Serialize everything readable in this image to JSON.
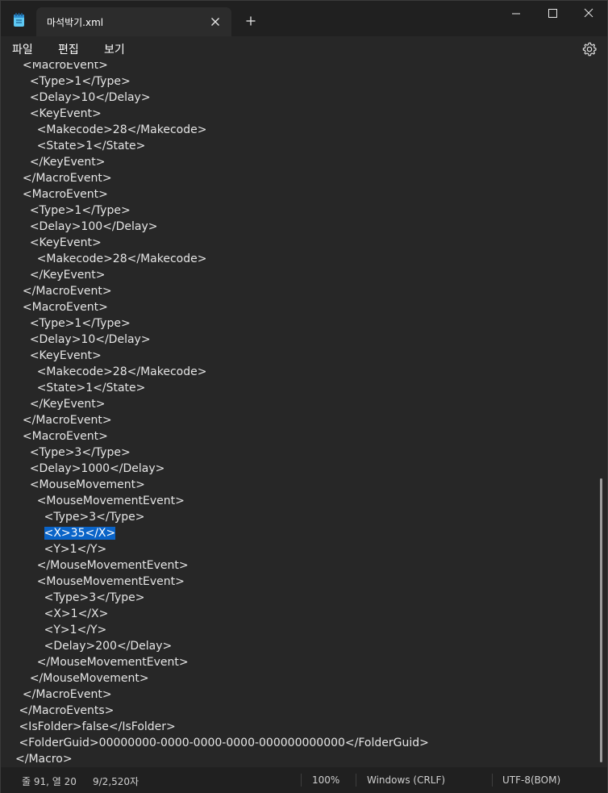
{
  "window": {
    "tab_title": "마석박기.xml"
  },
  "menu": {
    "file": "파일",
    "edit": "편집",
    "view": "보기"
  },
  "editor": {
    "lines": [
      {
        "indent": "  ",
        "text": "<MacroEvent>"
      },
      {
        "indent": "    ",
        "text": "<Type>1</Type>"
      },
      {
        "indent": "    ",
        "text": "<Delay>10</Delay>"
      },
      {
        "indent": "    ",
        "text": "<KeyEvent>"
      },
      {
        "indent": "      ",
        "text": "<Makecode>28</Makecode>"
      },
      {
        "indent": "      ",
        "text": "<State>1</State>"
      },
      {
        "indent": "    ",
        "text": "</KeyEvent>"
      },
      {
        "indent": "  ",
        "text": "</MacroEvent>"
      },
      {
        "indent": "  ",
        "text": "<MacroEvent>"
      },
      {
        "indent": "    ",
        "text": "<Type>1</Type>"
      },
      {
        "indent": "    ",
        "text": "<Delay>100</Delay>"
      },
      {
        "indent": "    ",
        "text": "<KeyEvent>"
      },
      {
        "indent": "      ",
        "text": "<Makecode>28</Makecode>"
      },
      {
        "indent": "    ",
        "text": "</KeyEvent>"
      },
      {
        "indent": "  ",
        "text": "</MacroEvent>"
      },
      {
        "indent": "  ",
        "text": "<MacroEvent>"
      },
      {
        "indent": "    ",
        "text": "<Type>1</Type>"
      },
      {
        "indent": "    ",
        "text": "<Delay>10</Delay>"
      },
      {
        "indent": "    ",
        "text": "<KeyEvent>"
      },
      {
        "indent": "      ",
        "text": "<Makecode>28</Makecode>"
      },
      {
        "indent": "      ",
        "text": "<State>1</State>"
      },
      {
        "indent": "    ",
        "text": "</KeyEvent>"
      },
      {
        "indent": "  ",
        "text": "</MacroEvent>"
      },
      {
        "indent": "  ",
        "text": "<MacroEvent>"
      },
      {
        "indent": "    ",
        "text": "<Type>3</Type>"
      },
      {
        "indent": "    ",
        "text": "<Delay>1000</Delay>"
      },
      {
        "indent": "    ",
        "text": "<MouseMovement>"
      },
      {
        "indent": "      ",
        "text": "<MouseMovementEvent>"
      },
      {
        "indent": "        ",
        "text": "<Type>3</Type>"
      },
      {
        "indent": "        ",
        "text": "<X>35</X>",
        "selected": true
      },
      {
        "indent": "        ",
        "text": "<Y>1</Y>"
      },
      {
        "indent": "      ",
        "text": "</MouseMovementEvent>"
      },
      {
        "indent": "      ",
        "text": "<MouseMovementEvent>"
      },
      {
        "indent": "        ",
        "text": "<Type>3</Type>"
      },
      {
        "indent": "        ",
        "text": "<X>1</X>"
      },
      {
        "indent": "        ",
        "text": "<Y>1</Y>"
      },
      {
        "indent": "        ",
        "text": "<Delay>200</Delay>"
      },
      {
        "indent": "      ",
        "text": "</MouseMovementEvent>"
      },
      {
        "indent": "    ",
        "text": "</MouseMovement>"
      },
      {
        "indent": "  ",
        "text": "</MacroEvent>"
      },
      {
        "indent": " ",
        "text": "</MacroEvents>"
      },
      {
        "indent": " ",
        "text": "<IsFolder>false</IsFolder>"
      },
      {
        "indent": " ",
        "text": "<FolderGuid>00000000-0000-0000-0000-000000000000</FolderGuid>"
      },
      {
        "indent": "",
        "text": "</Macro>"
      }
    ]
  },
  "status": {
    "position": "줄 91, 열 20",
    "count": "9/2,520자",
    "zoom": "100%",
    "line_ending": "Windows (CRLF)",
    "encoding": "UTF-8(BOM)"
  },
  "colors": {
    "selection": "#0a64c8",
    "background": "#272727",
    "titlebar": "#202020"
  }
}
